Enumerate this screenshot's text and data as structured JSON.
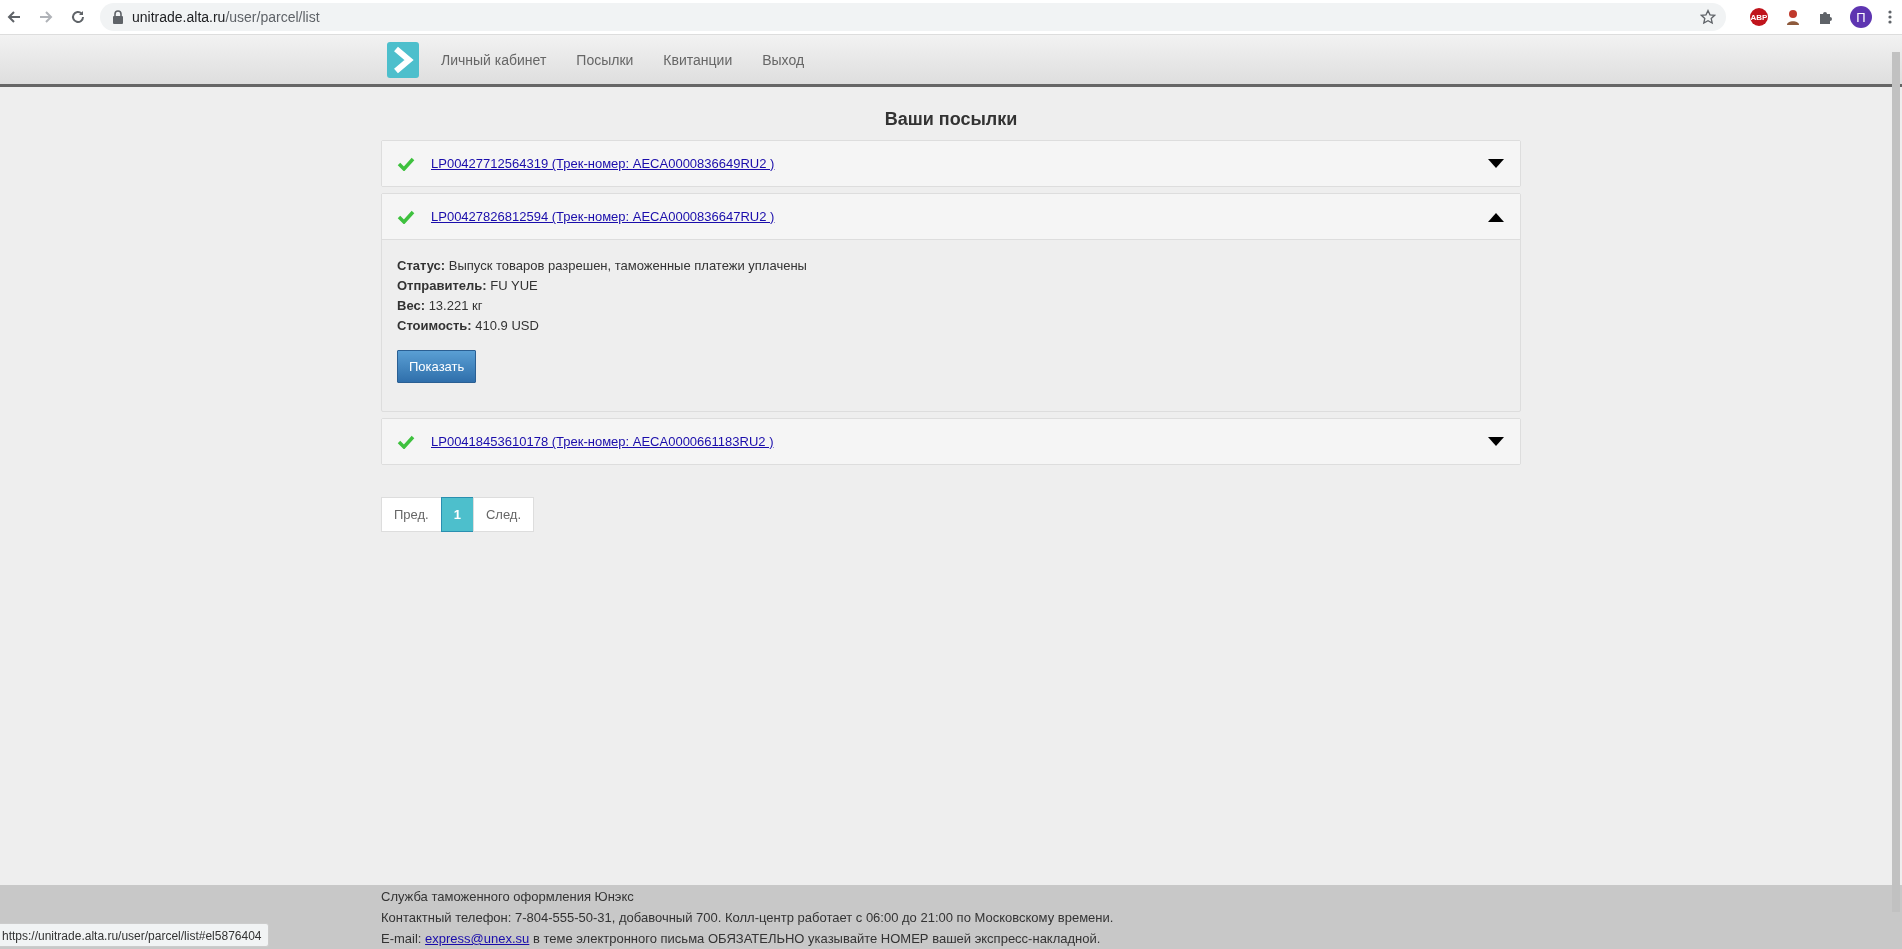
{
  "browser": {
    "url_host": "unitrade.alta.ru",
    "url_path": "/user/parcel/list",
    "extension_badge": "ABP",
    "profile_initial": "П"
  },
  "nav": {
    "items": [
      {
        "label": "Личный кабинет"
      },
      {
        "label": "Посылки"
      },
      {
        "label": "Квитанции"
      },
      {
        "label": "Выход"
      }
    ]
  },
  "page_title": "Ваши посылки",
  "parcels": [
    {
      "title": "LP00427712564319 (Трек-номер: AECA0000836649RU2 )",
      "done": true,
      "expanded": false
    },
    {
      "title": "LP00427826812594 (Трек-номер: AECA0000836647RU2 )",
      "done": true,
      "expanded": true,
      "details": [
        {
          "label": "Статус:",
          "value": "Выпуск товаров разрешен, таможенные платежи уплачены"
        },
        {
          "label": "Отправитель:",
          "value": "FU YUE"
        },
        {
          "label": "Вес:",
          "value": "13.221 кг"
        },
        {
          "label": "Стоимость:",
          "value": "410.9 USD"
        }
      ],
      "button": "Показать"
    },
    {
      "title": "LP00418453610178 (Трек-номер: AECA0000661183RU2 )",
      "done": true,
      "expanded": false
    }
  ],
  "pagination": [
    {
      "label": "Пред.",
      "selected": false
    },
    {
      "label": "1",
      "selected": true
    },
    {
      "label": "След.",
      "selected": false
    }
  ],
  "footer": {
    "lines": [
      "Служба таможенного оформления Юнэкс",
      "Контактный телефон: 7-804-555-50-31, добавочный 700. Колл-центр работает с 06:00 до 21:00 по Московскому времени."
    ],
    "email_line": {
      "before": "E-mail:",
      "link": "express@unex.su",
      "after": "в теме электронного письма ОБЯЗАТЕЛЬНО указывайте НОМЕР вашей экспресс-накладной."
    }
  },
  "status_bar": {
    "url": "https://unitrade.alta.ru/user/parcel/list#el5876404"
  }
}
